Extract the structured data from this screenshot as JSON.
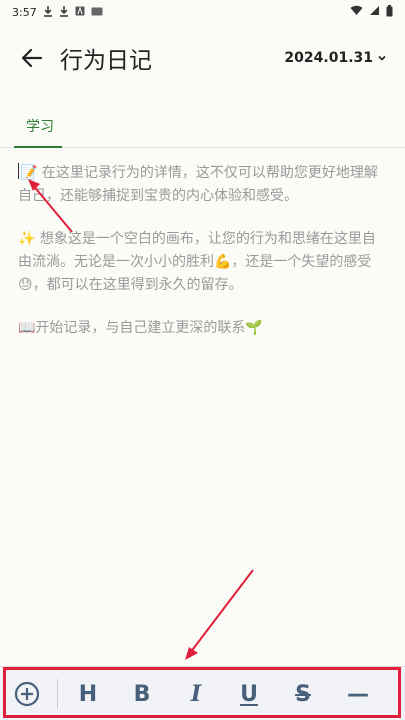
{
  "status_bar": {
    "time": "3:57",
    "left_icons": [
      "download-icon",
      "download-icon",
      "app-icon",
      "keyboard-icon"
    ],
    "right_icons": [
      "wifi-icon",
      "signal-icon",
      "battery-icon"
    ]
  },
  "header": {
    "title": "行为日记",
    "date": "2024.01.31"
  },
  "tabs": [
    {
      "label": "学习",
      "active": true
    }
  ],
  "editor": {
    "paragraphs": [
      "📝 在这里记录行为的详情，这不仅可以帮助您更好地理解自己，还能够捕捉到宝贵的内心体验和感受。",
      "✨ 想象这是一个空白的画布，让您的行为和思绪在这里自由流淌。无论是一次小小的胜利💪，还是一个失望的感受😓，都可以在这里得到永久的留存。",
      "📖开始记录，与自己建立更深的联系🌱"
    ]
  },
  "toolbar": {
    "items": [
      {
        "name": "add-icon",
        "label": "⊕"
      },
      {
        "name": "heading-button",
        "label": "H"
      },
      {
        "name": "bold-button",
        "label": "B"
      },
      {
        "name": "italic-button",
        "label": "I"
      },
      {
        "name": "underline-button",
        "label": "U"
      },
      {
        "name": "strikethrough-button",
        "label": "S"
      },
      {
        "name": "divider-button",
        "label": "—"
      }
    ]
  },
  "colors": {
    "accent": "#2e7d32",
    "toolbar_icon": "#48607a",
    "annotation": "#e0203a"
  }
}
